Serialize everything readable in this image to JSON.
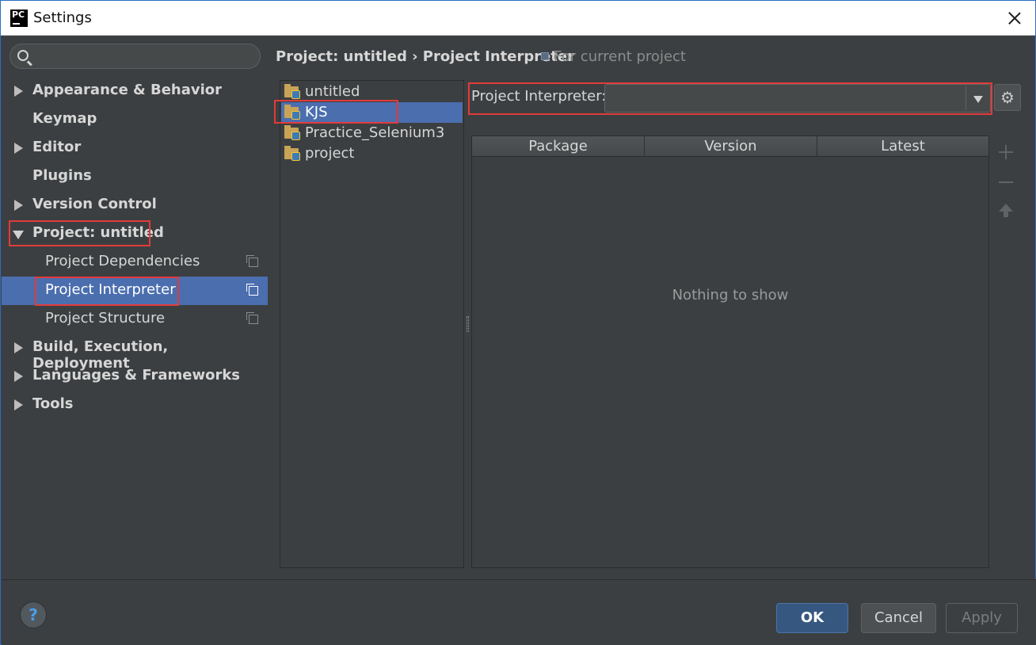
{
  "window": {
    "title": "Settings",
    "app_icon_text": "PC"
  },
  "sidebar": {
    "search_placeholder": "",
    "items": [
      {
        "label": "Appearance & Behavior",
        "arrow": "right"
      },
      {
        "label": "Keymap",
        "arrow": "none"
      },
      {
        "label": "Editor",
        "arrow": "right"
      },
      {
        "label": "Plugins",
        "arrow": "none"
      },
      {
        "label": "Version Control",
        "arrow": "right"
      },
      {
        "label": "Project: untitled",
        "arrow": "down"
      },
      {
        "label": "Project Dependencies",
        "arrow": "none",
        "sub": true
      },
      {
        "label": "Project Interpreter",
        "arrow": "none",
        "sub": true,
        "selected": true
      },
      {
        "label": "Project Structure",
        "arrow": "none",
        "sub": true
      },
      {
        "label": "Build, Execution, Deployment",
        "arrow": "right"
      },
      {
        "label": "Languages & Frameworks",
        "arrow": "right"
      },
      {
        "label": "Tools",
        "arrow": "right"
      }
    ]
  },
  "content": {
    "breadcrumb": "Project: untitled › Project Interpreter",
    "hint": "For current project",
    "projects": [
      "untitled",
      "KJS",
      "Practice_Selenium3",
      "project"
    ],
    "selected_project": "KJS",
    "interpreter_label": "Project Interpreter:",
    "interpreter_value": "",
    "table": {
      "columns": [
        "Package",
        "Version",
        "Latest"
      ],
      "empty_text": "Nothing to show"
    }
  },
  "footer": {
    "help_label": "?",
    "ok_label": "OK",
    "cancel_label": "Cancel",
    "apply_label": "Apply"
  },
  "colors": {
    "background": "#3c3f41",
    "selection": "#4b6eaf",
    "highlight_box": "#e13b3b",
    "ok_button": "#365880"
  }
}
